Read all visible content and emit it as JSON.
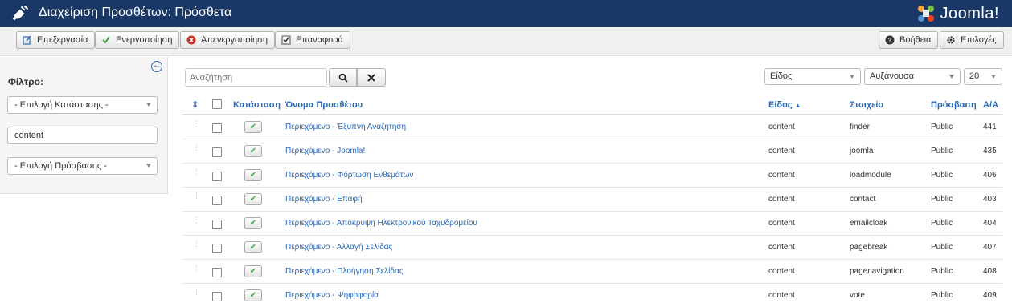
{
  "header": {
    "title": "Διαχείριση Προσθέτων: Πρόσθετα",
    "logo_text": "Joomla!"
  },
  "toolbar": {
    "edit": "Επεξεργασία",
    "enable": "Ενεργοποίηση",
    "disable": "Απενεργοποίηση",
    "checkin": "Επαναφορά",
    "help": "Βοήθεια",
    "options": "Επιλογές"
  },
  "sidebar": {
    "filter_label": "Φίλτρο:",
    "status_select": "- Επιλογή Κατάστασης -",
    "folder_select": "content",
    "access_select": "- Επιλογή Πρόσβασης -"
  },
  "search": {
    "placeholder": "Αναζήτηση",
    "sort_field": "Είδος",
    "sort_dir": "Αυξάνουσα",
    "limit": "20"
  },
  "table": {
    "headers": {
      "status": "Κατάσταση",
      "name": "Όνομα Προσθέτου",
      "type": "Είδος",
      "element": "Στοιχείο",
      "access": "Πρόσβαση",
      "id": "Α/Α"
    },
    "rows": [
      {
        "name": "Περιεχόμενο - Έξυπνη Αναζήτηση",
        "type": "content",
        "element": "finder",
        "access": "Public",
        "id": "441"
      },
      {
        "name": "Περιεχόμενο - Joomla!",
        "type": "content",
        "element": "joomla",
        "access": "Public",
        "id": "435"
      },
      {
        "name": "Περιεχόμενο - Φόρτωση Ενθεμάτων",
        "type": "content",
        "element": "loadmodule",
        "access": "Public",
        "id": "406"
      },
      {
        "name": "Περιεχόμενο - Επαφή",
        "type": "content",
        "element": "contact",
        "access": "Public",
        "id": "403"
      },
      {
        "name": "Περιεχόμενο - Απόκρυψη Ηλεκτρονικού Ταχυδρομείου",
        "type": "content",
        "element": "emailcloak",
        "access": "Public",
        "id": "404"
      },
      {
        "name": "Περιεχόμενο - Αλλαγή Σελίδας",
        "type": "content",
        "element": "pagebreak",
        "access": "Public",
        "id": "407"
      },
      {
        "name": "Περιεχόμενο - Πλοήγηση Σελίδας",
        "type": "content",
        "element": "pagenavigation",
        "access": "Public",
        "id": "408"
      },
      {
        "name": "Περιεχόμενο - Ψηφοφορία",
        "type": "content",
        "element": "vote",
        "access": "Public",
        "id": "409"
      }
    ]
  },
  "colors": {
    "header_bg": "#1a3867",
    "link": "#2a69b8",
    "enabled_check": "#46a546",
    "disable_icon": "#c9302c"
  }
}
